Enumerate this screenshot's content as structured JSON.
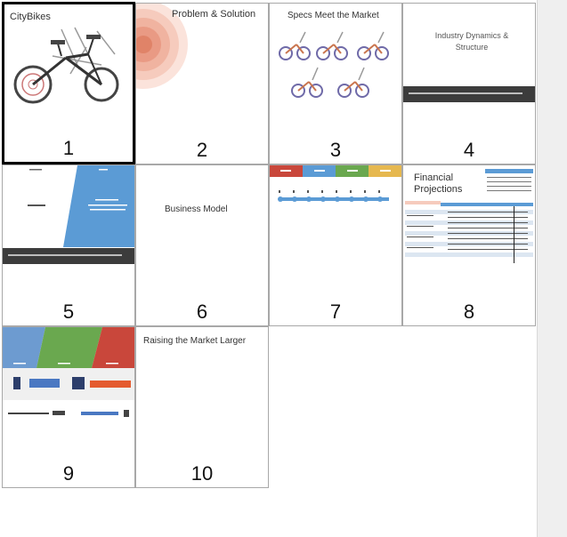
{
  "slides": [
    {
      "number": "1",
      "title": "CityBikes",
      "selected": true
    },
    {
      "number": "2",
      "title": "Problem & Solution"
    },
    {
      "number": "3",
      "title": "Specs Meet the Market"
    },
    {
      "number": "4",
      "title": "Industry Dynamics & Structure"
    },
    {
      "number": "5",
      "title": ""
    },
    {
      "number": "6",
      "title": "Business Model"
    },
    {
      "number": "7",
      "title": ""
    },
    {
      "number": "8",
      "title": "Financial Projections"
    },
    {
      "number": "9",
      "title": ""
    },
    {
      "number": "10",
      "title": "Raising the Market Larger"
    }
  ],
  "colors": {
    "accent_blue": "#5b9bd5",
    "red": "#c9473b",
    "green": "#6aa84f",
    "yellow": "#e6b84f",
    "dark": "#3c3c3c",
    "selected_border": "#000000",
    "tile_border": "#a8a8a8"
  }
}
